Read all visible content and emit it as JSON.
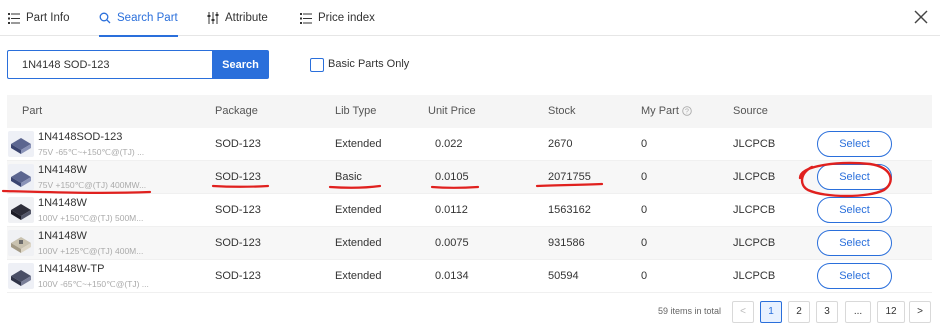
{
  "tabs": [
    {
      "label": "Part Info",
      "icon": "list-icon"
    },
    {
      "label": "Search Part",
      "icon": "search-icon",
      "active": true
    },
    {
      "label": "Attribute",
      "icon": "sliders-icon"
    },
    {
      "label": "Price index",
      "icon": "list-icon"
    }
  ],
  "search": {
    "value": "1N4148 SOD-123",
    "button_label": "Search"
  },
  "basic_parts": {
    "label": "Basic Parts Only",
    "checked": false
  },
  "table": {
    "headers": {
      "part": "Part",
      "package": "Package",
      "lib_type": "Lib Type",
      "unit_price": "Unit Price",
      "stock": "Stock",
      "my_part": "My Part",
      "source": "Source"
    },
    "rows": [
      {
        "name": "1N4148SOD-123",
        "desc": "75V -65℃~+150℃@(TJ) ...",
        "package": "SOD-123",
        "lib_type": "Extended",
        "unit_price": "0.022",
        "stock": "2670",
        "my_part": "0",
        "source": "JLCPCB",
        "action": "Select"
      },
      {
        "name": "1N4148W",
        "desc": "75V +150℃@(TJ) 400MW...",
        "package": "SOD-123",
        "lib_type": "Basic",
        "unit_price": "0.0105",
        "stock": "2071755",
        "my_part": "0",
        "source": "JLCPCB",
        "action": "Select"
      },
      {
        "name": "1N4148W",
        "desc": "100V +150℃@(TJ) 500M...",
        "package": "SOD-123",
        "lib_type": "Extended",
        "unit_price": "0.0112",
        "stock": "1563162",
        "my_part": "0",
        "source": "JLCPCB",
        "action": "Select"
      },
      {
        "name": "1N4148W",
        "desc": "100V +125℃@(TJ) 400M...",
        "package": "SOD-123",
        "lib_type": "Extended",
        "unit_price": "0.0075",
        "stock": "931586",
        "my_part": "0",
        "source": "JLCPCB",
        "action": "Select"
      },
      {
        "name": "1N4148W-TP",
        "desc": "100V -65℃~+150℃@(TJ) ...",
        "package": "SOD-123",
        "lib_type": "Extended",
        "unit_price": "0.0134",
        "stock": "50594",
        "my_part": "0",
        "source": "JLCPCB",
        "action": "Select"
      }
    ]
  },
  "pagination": {
    "total_text": "59 items in total",
    "prev": "<",
    "next": ">",
    "pages": [
      "1",
      "2",
      "3",
      "...",
      "12"
    ],
    "current": "1"
  },
  "colors": {
    "accent": "#2a6fdb",
    "annotation": "#e0201e"
  }
}
